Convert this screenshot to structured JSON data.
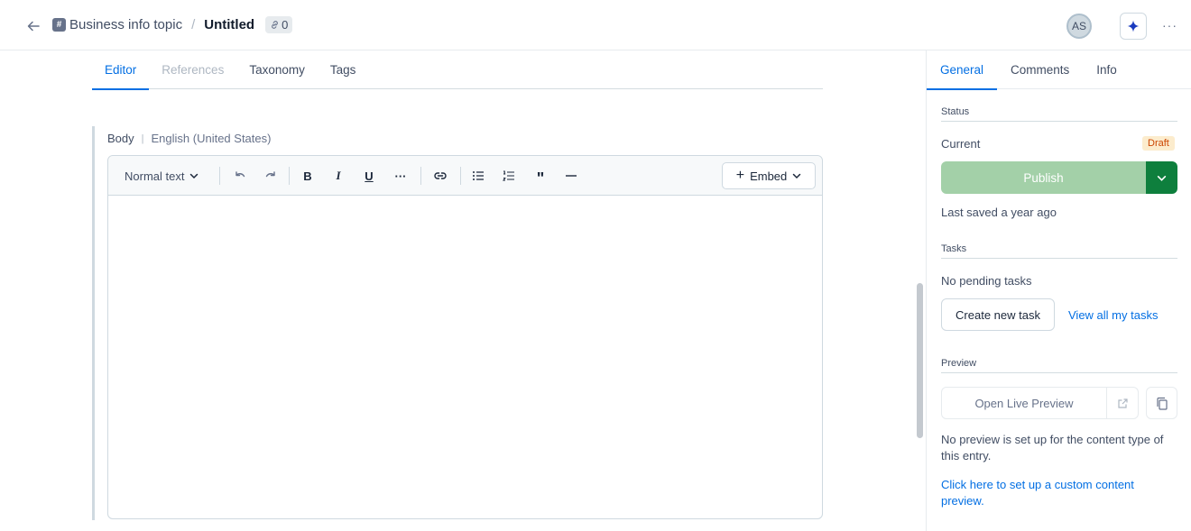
{
  "header": {
    "content_type_icon": "hashtag-icon",
    "content_type": "Business info topic",
    "separator": "/",
    "title": "Untitled",
    "references_count": "0",
    "avatar_initials": "AS"
  },
  "editor_tabs": [
    {
      "label": "Editor",
      "state": "active"
    },
    {
      "label": "References",
      "state": "disabled"
    },
    {
      "label": "Taxonomy",
      "state": "normal"
    },
    {
      "label": "Tags",
      "state": "normal"
    }
  ],
  "field": {
    "label": "Body",
    "locale": "English (United States)"
  },
  "toolbar": {
    "text_style": "Normal text",
    "embed_label": "Embed"
  },
  "sidebar": {
    "tabs": [
      {
        "label": "General",
        "state": "active"
      },
      {
        "label": "Comments",
        "state": "normal"
      },
      {
        "label": "Info",
        "state": "normal"
      }
    ],
    "status": {
      "heading": "Status",
      "current_label": "Current",
      "badge": "Draft",
      "publish_label": "Publish",
      "last_saved": "Last saved a year ago"
    },
    "tasks": {
      "heading": "Tasks",
      "empty_text": "No pending tasks",
      "create_label": "Create new task",
      "view_all_label": "View all my tasks"
    },
    "preview": {
      "heading": "Preview",
      "open_label": "Open Live Preview",
      "note": "No preview is set up for the content type of this entry.",
      "setup_link": "Click here to set up a custom content preview."
    }
  },
  "colors": {
    "accent": "#036fe3",
    "publish_disabled": "#a3d0a8",
    "publish_dark": "#0e7f3d",
    "draft_bg": "#fceccd",
    "draft_text": "#cc4500"
  }
}
